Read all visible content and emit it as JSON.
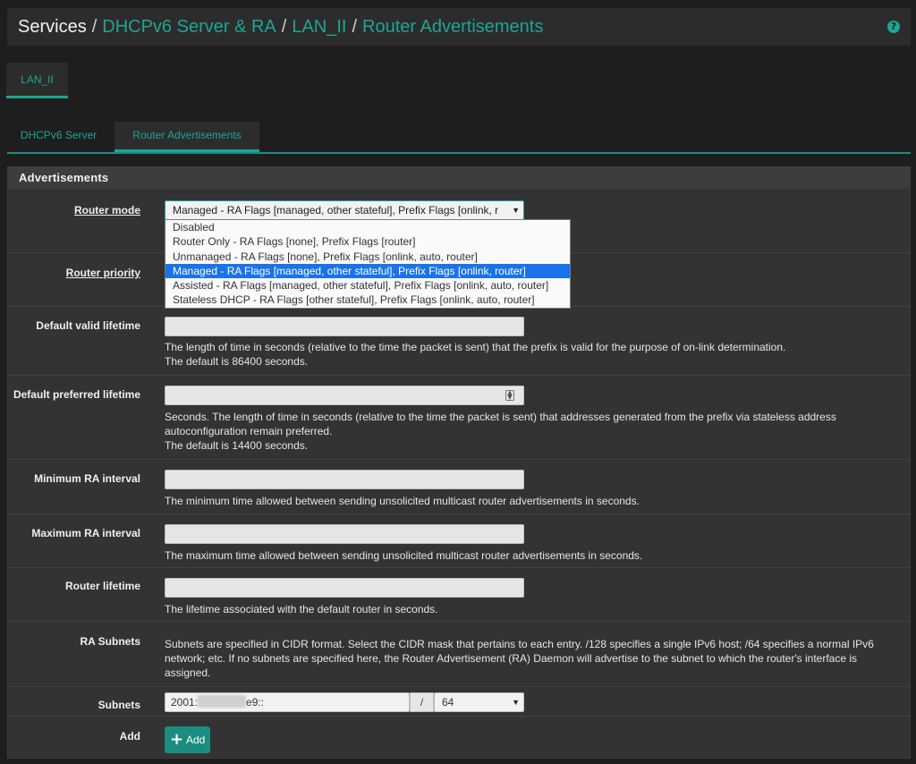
{
  "breadcrumb": {
    "root": "Services",
    "items": [
      "DHCPv6 Server & RA",
      "LAN_II",
      "Router Advertisements"
    ],
    "separator": "/"
  },
  "help_icon": "question-circle-icon",
  "interface_tab": "LAN_II",
  "subtabs": [
    "DHCPv6 Server",
    "Router Advertisements"
  ],
  "panel_title": "Advertisements",
  "router_mode": {
    "label": "Router mode",
    "value": "Managed - RA Flags [managed, other stateful], Prefix Flags [onlink, r",
    "options": [
      "Disabled",
      "Router Only - RA Flags [none], Prefix Flags [router]",
      "Unmanaged - RA Flags [none], Prefix Flags [onlink, auto, router]",
      "Managed - RA Flags [managed, other stateful], Prefix Flags [onlink, router]",
      "Assisted - RA Flags [managed, other stateful], Prefix Flags [onlink, auto, router]",
      "Stateless DHCP - RA Flags [other stateful], Prefix Flags [onlink, auto, router]"
    ],
    "selected_index": 3
  },
  "router_priority": {
    "label": "Router priority"
  },
  "valid_lifetime": {
    "label": "Default valid lifetime",
    "help": "The length of time in seconds (relative to the time the packet is sent) that the prefix is valid for the purpose of on-link determination.",
    "default": "The default is 86400 seconds."
  },
  "preferred_lifetime": {
    "label": "Default preferred lifetime",
    "help": "Seconds. The length of time in seconds (relative to the time the packet is sent) that addresses generated from the prefix via stateless address autoconfiguration remain preferred.",
    "default": "The default is 14400 seconds."
  },
  "min_ra": {
    "label": "Minimum RA interval",
    "help": "The minimum time allowed between sending unsolicited multicast router advertisements in seconds."
  },
  "max_ra": {
    "label": "Maximum RA interval",
    "help": "The maximum time allowed between sending unsolicited multicast router advertisements in seconds."
  },
  "router_lifetime": {
    "label": "Router lifetime",
    "help": "The lifetime associated with the default router in seconds."
  },
  "ra_subnets": {
    "label": "RA Subnets",
    "help": "Subnets are specified in CIDR format. Select the CIDR mask that pertains to each entry. /128 specifies a single IPv6 host; /64 specifies a normal IPv6 network; etc. If no subnets are specified here, the Router Advertisement (RA) Daemon will advertise to the subnet to which the router's interface is assigned."
  },
  "subnets": {
    "label": "Subnets",
    "address_prefix": "2001:",
    "address_suffix": "e9::",
    "slash": "/",
    "mask": "64"
  },
  "add": {
    "label": "Add",
    "button": "Add"
  },
  "colors": {
    "accent": "#1fa493",
    "selected": "#1a73e8",
    "background": "#1e1e1e",
    "panel": "#333333"
  }
}
